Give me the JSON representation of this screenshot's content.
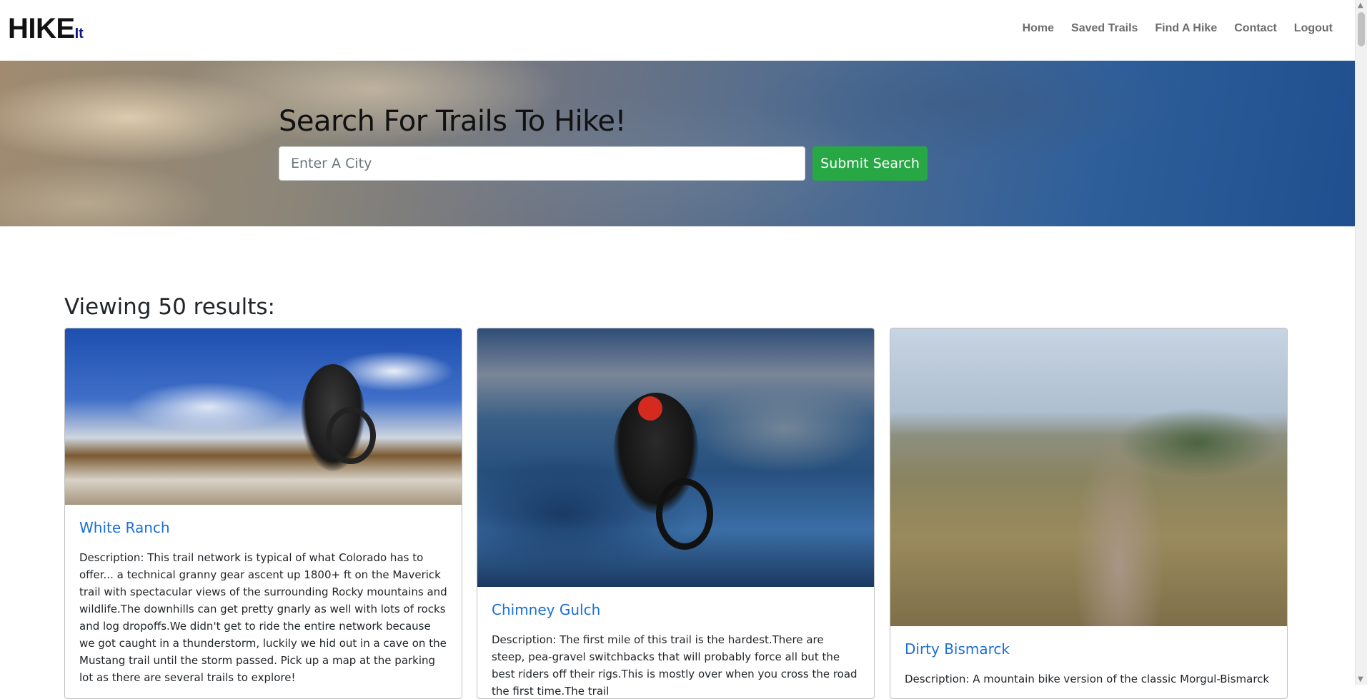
{
  "brand": {
    "main": "HIKE",
    "suffix": "It"
  },
  "nav": {
    "items": [
      {
        "label": "Home"
      },
      {
        "label": "Saved Trails"
      },
      {
        "label": "Find A Hike"
      },
      {
        "label": "Contact"
      },
      {
        "label": "Logout"
      }
    ]
  },
  "hero": {
    "title": "Search For Trails To Hike!",
    "search_placeholder": "Enter A City",
    "submit_label": "Submit Search"
  },
  "results": {
    "heading": "Viewing 50 results:",
    "cards": [
      {
        "title": "White Ranch",
        "description": "Description: This trail network is typical of what Colorado has to offer... a technical granny gear ascent up 1800+ ft on the Maverick trail with spectacular views of the surrounding Rocky mountains and wildlife.The downhills can get pretty gnarly as well with lots of rocks and log dropoffs.We didn't get to ride the entire network because we got caught in a thunderstorm, luckily we hid out in a cave on the Mustang trail until the storm passed. Pick up a map at the parking lot as there are several trails to explore!"
      },
      {
        "title": "Chimney Gulch",
        "description": "Description: The first mile of this trail is the hardest.There are steep, pea-gravel switchbacks that will probably force all but the best riders off their rigs.This is mostly over when you cross the road the first time.The trail"
      },
      {
        "title": "Dirty Bismarck",
        "description": "Description: A mountain bike version of the classic Morgul-Bismarck"
      }
    ]
  }
}
